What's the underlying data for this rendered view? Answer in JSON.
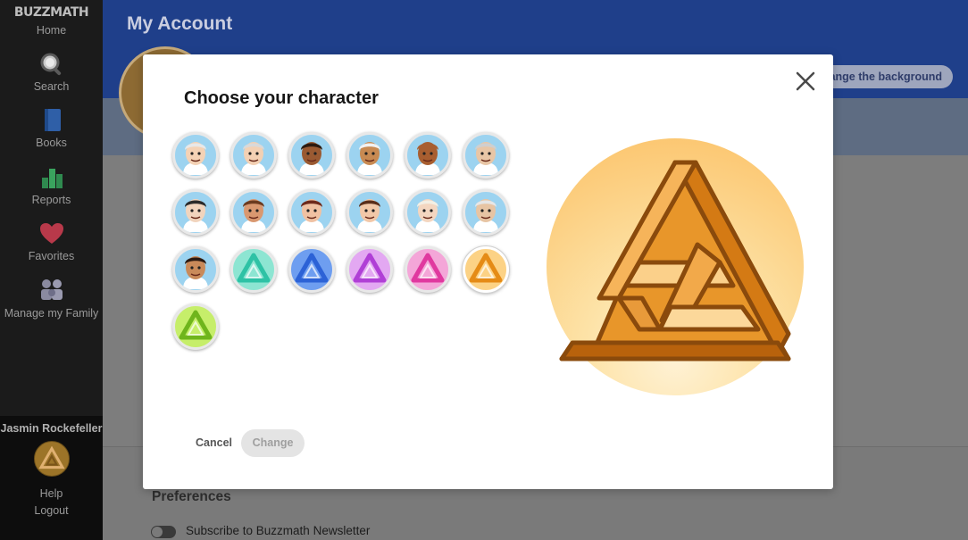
{
  "sidebar": {
    "logo": "BUZZMATH",
    "items": [
      {
        "label": "Home",
        "icon": "home-icon"
      },
      {
        "label": "Search",
        "icon": "search-icon"
      },
      {
        "label": "Books",
        "icon": "book-icon"
      },
      {
        "label": "Reports",
        "icon": "bar-chart-icon"
      },
      {
        "label": "Favorites",
        "icon": "heart-icon"
      },
      {
        "label": "Manage my Family",
        "icon": "family-icon"
      }
    ],
    "user": {
      "name": "Jasmin Rockefeller",
      "help": "Help",
      "logout": "Logout"
    }
  },
  "page": {
    "title": "My Account",
    "change_background": "Change the background",
    "preferences_title": "Preferences",
    "newsletter_label": "Subscribe to Buzzmath Newsletter",
    "newsletter_on": false
  },
  "modal": {
    "title": "Choose your character",
    "cancel": "Cancel",
    "change": "Change",
    "selected_index": 17,
    "characters": [
      {
        "kind": "face",
        "name": "elderly-scientist-avatar",
        "bg": "#9cd3f0",
        "skin": "#f4d2b5",
        "hair": "#e8e8e8"
      },
      {
        "kind": "face",
        "name": "grandmother-avatar",
        "bg": "#9cd3f0",
        "skin": "#f3d0b3",
        "hair": "#d9d9d9"
      },
      {
        "kind": "face",
        "name": "young-man-avatar",
        "bg": "#9cd3f0",
        "skin": "#9a5a32",
        "hair": "#2b1a10"
      },
      {
        "kind": "face",
        "name": "turban-man-avatar",
        "bg": "#9cd3f0",
        "skin": "#c88a52",
        "hair": "#f1f1f1"
      },
      {
        "kind": "face",
        "name": "bald-man-avatar",
        "bg": "#9cd3f0",
        "skin": "#a85e30",
        "hair": "#a85e30"
      },
      {
        "kind": "face",
        "name": "bald-elder-avatar",
        "bg": "#9cd3f0",
        "skin": "#e8c6a6",
        "hair": "#cfcfcf"
      },
      {
        "kind": "face",
        "name": "man-dark-hair-avatar",
        "bg": "#9cd3f0",
        "skin": "#f1d4bd",
        "hair": "#2a2a2a"
      },
      {
        "kind": "face",
        "name": "bearded-man-avatar",
        "bg": "#9cd3f0",
        "skin": "#d99870",
        "hair": "#6b3a1f"
      },
      {
        "kind": "face",
        "name": "woman-red-hair-avatar",
        "bg": "#9cd3f0",
        "skin": "#f0c1a2",
        "hair": "#6e2a1c"
      },
      {
        "kind": "face",
        "name": "woman-brown-hair-avatar",
        "bg": "#9cd3f0",
        "skin": "#f2c8a8",
        "hair": "#5a2e1a"
      },
      {
        "kind": "face",
        "name": "woman-blonde-avatar",
        "bg": "#9cd3f0",
        "skin": "#f3d6c0",
        "hair": "#f3efe4"
      },
      {
        "kind": "face",
        "name": "white-beard-elder-avatar",
        "bg": "#9cd3f0",
        "skin": "#e7c4a3",
        "hair": "#e6e6e6"
      },
      {
        "kind": "face",
        "name": "woman-curly-hair-avatar",
        "bg": "#9cd3f0",
        "skin": "#c98a5a",
        "hair": "#2b1a12"
      },
      {
        "kind": "shape",
        "name": "teal-knot-avatar",
        "bg": "#8de5d2",
        "color": "#2ec2a5"
      },
      {
        "kind": "shape",
        "name": "blue-cube-avatar",
        "bg": "#6e9ef0",
        "color": "#2c62d6"
      },
      {
        "kind": "shape",
        "name": "purple-hourglass-avatar",
        "bg": "#e3a8f2",
        "color": "#b03fd6"
      },
      {
        "kind": "shape",
        "name": "pink-triangle-avatar",
        "bg": "#f4a6d8",
        "color": "#e0399f"
      },
      {
        "kind": "shape",
        "name": "orange-triangle-avatar",
        "bg": "#fcd285",
        "color": "#e58b16"
      },
      {
        "kind": "shape",
        "name": "green-impossible-avatar",
        "bg": "#c6ee6a",
        "color": "#6fb51c"
      }
    ]
  },
  "colors": {
    "banner": "#1f3f8a",
    "preview_bg": "#fbc064",
    "selected_shape": "#e58b16"
  }
}
